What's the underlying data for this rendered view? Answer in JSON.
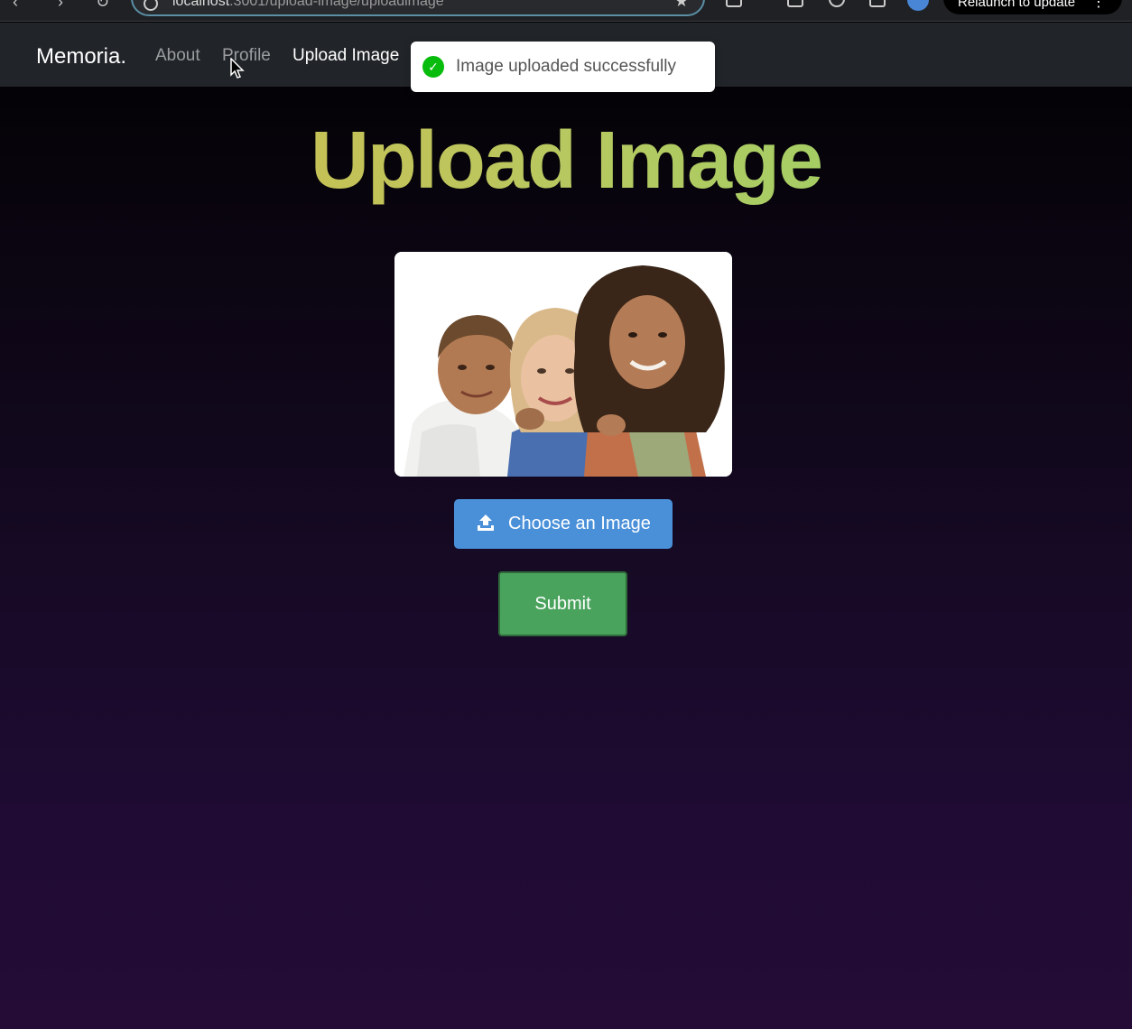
{
  "browser": {
    "url_host": "localhost",
    "url_path": ":3001/upload-image/uploadimage",
    "relaunch_label": "Relaunch to update"
  },
  "navbar": {
    "brand": "Memoria.",
    "links": [
      {
        "label": "About",
        "active": false
      },
      {
        "label": "Profile",
        "active": false
      },
      {
        "label": "Upload Image",
        "active": true
      }
    ]
  },
  "toast": {
    "message": "Image uploaded successfully",
    "status": "success",
    "icon": "check-circle-icon"
  },
  "main": {
    "title": "Upload Image",
    "choose_button_label": "Choose an Image",
    "choose_button_icon": "upload-icon",
    "submit_label": "Submit"
  },
  "colors": {
    "primary_button": "#4a90d9",
    "submit_button": "#4aa35d",
    "title_gradient_start": "#d3b94a",
    "title_gradient_end": "#8fd46a"
  }
}
